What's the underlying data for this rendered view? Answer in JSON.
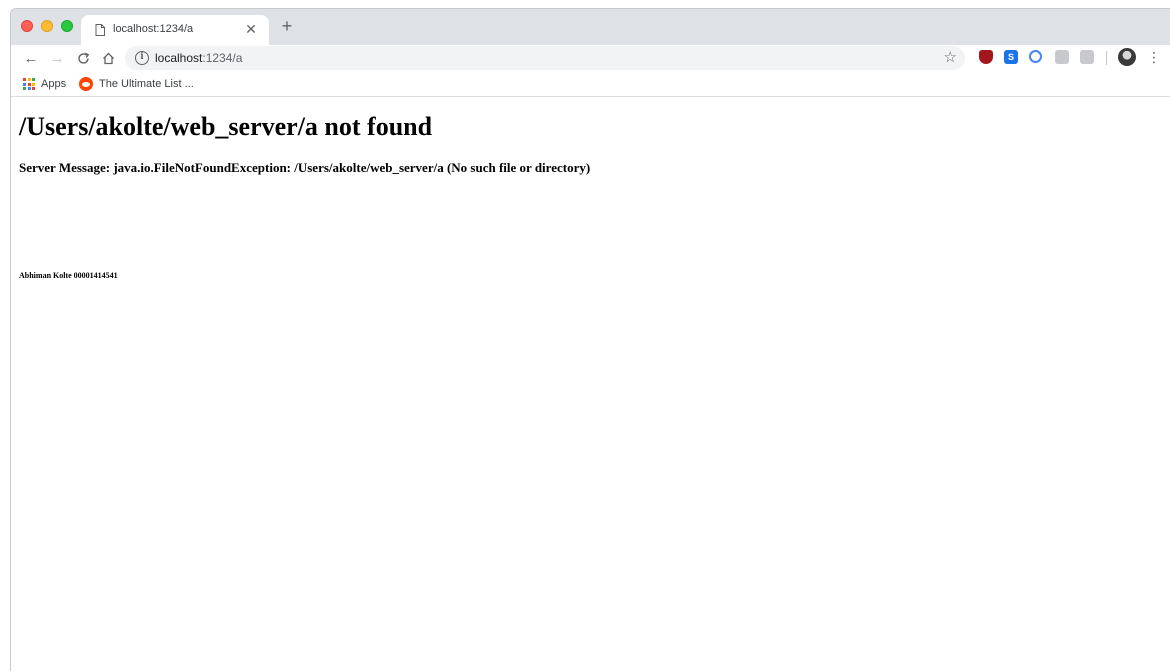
{
  "browser": {
    "tab": {
      "title": "localhost:1234/a",
      "close_icon": "close-icon",
      "page_icon": "document-icon"
    },
    "new_tab_label": "+",
    "toolbar": {
      "back_icon": "back-arrow-icon",
      "forward_icon": "forward-arrow-icon",
      "reload_icon": "reload-icon",
      "home_icon": "home-icon",
      "url_host": "localhost",
      "url_rest": ":1234/a",
      "info_icon": "info-icon",
      "star_icon": "star-icon",
      "menu_icon": "kebab-menu-icon"
    },
    "extensions": [
      "ublock-icon",
      "s-extension-icon",
      "sync-icon",
      "grey-extension-icon",
      "grey-extension-icon-2"
    ],
    "bookmarks": [
      {
        "label": "Apps",
        "icon": "apps-grid-icon"
      },
      {
        "label": "The Ultimate List ...",
        "icon": "reddit-icon"
      }
    ]
  },
  "page": {
    "heading": "/Users/akolte/web_server/a not found",
    "message": "Server Message: java.io.FileNotFoundException: /Users/akolte/web_server/a (No such file or directory)",
    "footer": "Abhiman Kolte 00001414541"
  },
  "colors": {
    "tabstrip": "#dee1e6",
    "omnibox": "#f1f3f4",
    "traffic_red": "#fe5f57",
    "traffic_yellow": "#febc2e",
    "traffic_green": "#28c840"
  }
}
